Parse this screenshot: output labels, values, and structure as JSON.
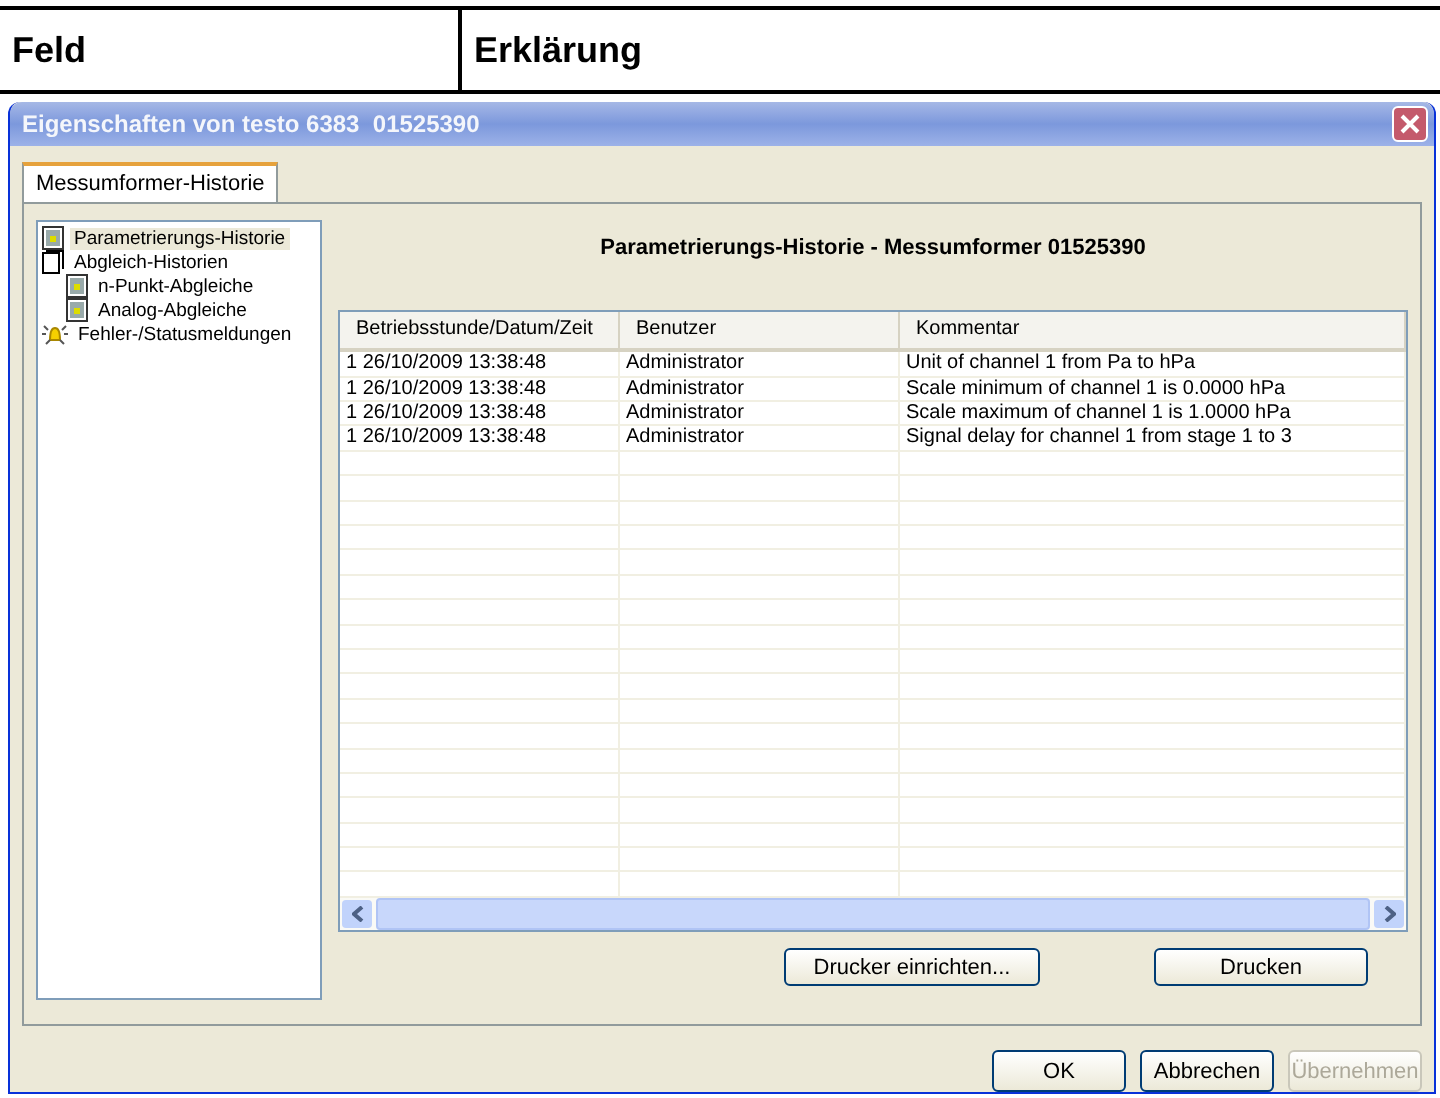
{
  "header_table": {
    "columns": [
      "Feld",
      "Erklärung"
    ]
  },
  "window": {
    "title": "Eigenschaften von testo 6383  01525390"
  },
  "tabs": [
    {
      "label": "Messumformer-Historie",
      "selected": true
    }
  ],
  "tree": [
    {
      "label": "Parametrierungs-Historie",
      "kind": "doc",
      "selected": true
    },
    {
      "label": "Abgleich-Historien",
      "kind": "page",
      "selected": false,
      "children": [
        {
          "label": "n-Punkt-Abgleiche",
          "kind": "doc",
          "selected": false
        },
        {
          "label": "Analog-Abgleiche",
          "kind": "doc",
          "selected": false
        }
      ]
    },
    {
      "label": "Fehler-/Statusmeldungen",
      "kind": "bell",
      "selected": false
    }
  ],
  "panel_title": "Parametrierungs-Historie - Messumformer 01525390",
  "table": {
    "columns": [
      "Betriebsstunde/Datum/Zeit",
      "Benutzer",
      "Kommentar"
    ],
    "rows": [
      [
        "1 26/10/2009 13:38:48",
        "Administrator",
        "Unit of channel 1 from Pa to hPa"
      ],
      [
        "1 26/10/2009 13:38:48",
        "Administrator",
        "Scale minimum of channel 1 is 0.0000 hPa"
      ],
      [
        "1 26/10/2009 13:38:48",
        "Administrator",
        "Scale maximum of channel 1 is 1.0000 hPa"
      ],
      [
        "1 26/10/2009 13:38:48",
        "Administrator",
        "Signal delay for channel 1 from stage 1 to 3"
      ]
    ]
  },
  "panel_buttons": [
    {
      "label": "Drucker einrichten...",
      "disabled": false
    },
    {
      "label": "Drucken",
      "disabled": false
    }
  ],
  "dialog_buttons": [
    {
      "label": "OK",
      "disabled": false
    },
    {
      "label": "Abbrechen",
      "disabled": false
    },
    {
      "label": "Übernehmen",
      "disabled": true
    }
  ]
}
